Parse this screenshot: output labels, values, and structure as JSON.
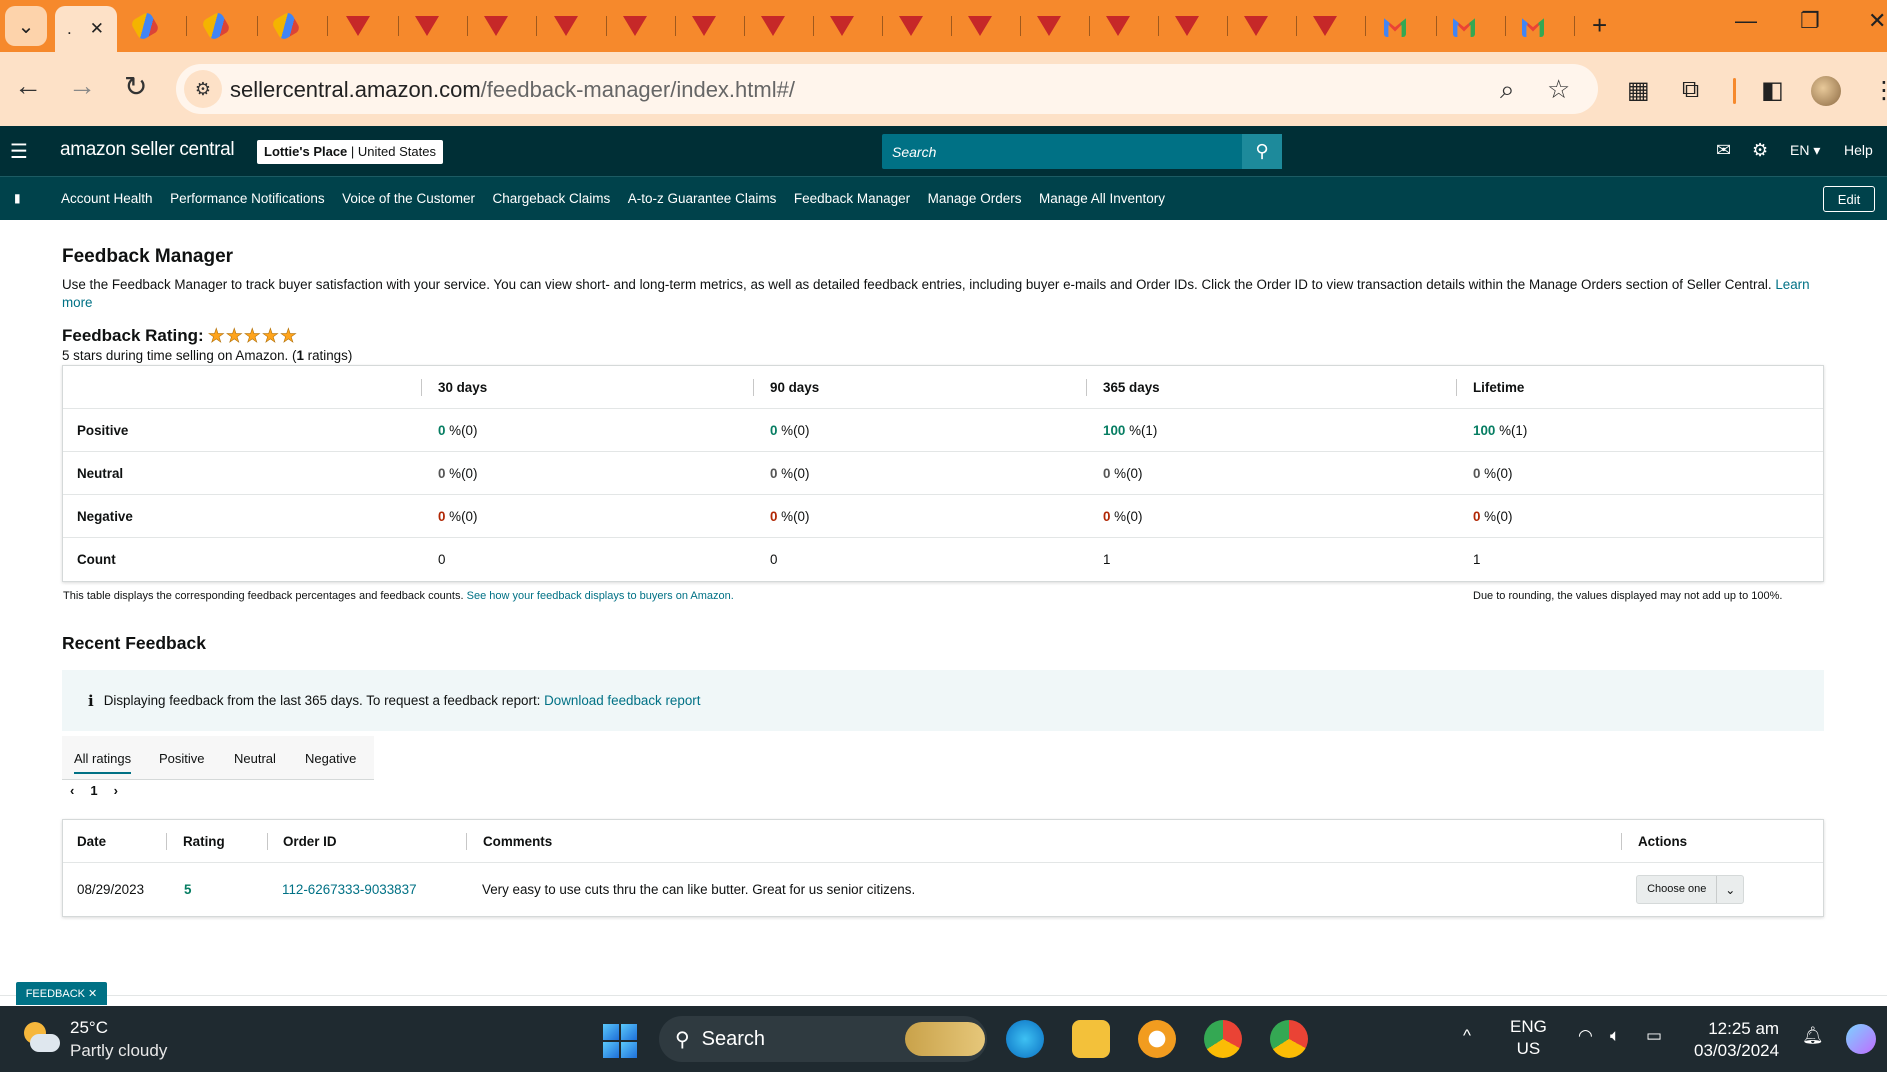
{
  "browser": {
    "tab_search_icon": "chevron-down-icon",
    "active_tab": {
      "label": ".",
      "close": "✕"
    },
    "new_tab": "+",
    "url_host": "sellercentral.amazon.com",
    "url_path": "/feedback-manager/index.html#/",
    "window_controls": [
      "—",
      "❐",
      "✕"
    ]
  },
  "header": {
    "logo_text": "amazon seller central",
    "store_name": "Lottie's Place",
    "store_region": "United States",
    "search_placeholder": "Search",
    "language": "EN ▾",
    "help": "Help"
  },
  "nav": {
    "items": [
      "Account Health",
      "Performance Notifications",
      "Voice of the Customer",
      "Chargeback Claims",
      "A-to-z Guarantee Claims",
      "Feedback Manager",
      "Manage Orders",
      "Manage All Inventory"
    ],
    "edit": "Edit"
  },
  "page": {
    "title": "Feedback Manager",
    "description": "Use the Feedback Manager to track buyer satisfaction with your service. You can view short- and long-term metrics, as well as detailed feedback entries, including buyer e-mails and Order IDs. Click the Order ID to view transaction details within the Manage Orders section of Seller Central.",
    "learn_more": "Learn more",
    "rating_label": "Feedback Rating:",
    "rating_stars": 5,
    "rating_sub_pre": "5 stars during time selling on Amazon. (",
    "rating_sub_count": "1",
    "rating_sub_post": " ratings)"
  },
  "ratings_table": {
    "columns": [
      "30 days",
      "90 days",
      "365 days",
      "Lifetime"
    ],
    "rows": [
      {
        "label": "Positive",
        "cells": [
          [
            "0",
            " %(0)"
          ],
          [
            "0",
            " %(0)"
          ],
          [
            "100",
            " %(1)"
          ],
          [
            "100",
            " %(1)"
          ]
        ]
      },
      {
        "label": "Neutral",
        "cells": [
          [
            "0",
            " %(0)"
          ],
          [
            "0",
            " %(0)"
          ],
          [
            "0",
            " %(0)"
          ],
          [
            "0",
            " %(0)"
          ]
        ]
      },
      {
        "label": "Negative",
        "cells": [
          [
            "0",
            " %(0)"
          ],
          [
            "0",
            " %(0)"
          ],
          [
            "0",
            " %(0)"
          ],
          [
            "0",
            " %(0)"
          ]
        ]
      },
      {
        "label": "Count",
        "cells": [
          [
            "0",
            ""
          ],
          [
            "0",
            ""
          ],
          [
            "1",
            ""
          ],
          [
            "1",
            ""
          ]
        ]
      }
    ],
    "note": "This table displays the corresponding feedback percentages and feedback counts.",
    "note_link": "See how your feedback displays to buyers on Amazon.",
    "rounding_note": "Due to rounding, the values displayed may not add up to 100%."
  },
  "recent": {
    "title": "Recent Feedback",
    "info_text": "Displaying feedback from the last 365 days. To request a feedback report:",
    "info_link": "Download feedback report",
    "tabs": [
      "All ratings",
      "Positive",
      "Neutral",
      "Negative"
    ],
    "page": "1",
    "columns": [
      "Date",
      "Rating",
      "Order ID",
      "Comments",
      "Actions"
    ],
    "rows": [
      {
        "date": "08/29/2023",
        "rating": "5",
        "order_id": "112-6267333-9033837",
        "comment": "Very easy to use cuts thru the can like butter. Great for us senior citizens.",
        "action": "Choose one"
      }
    ]
  },
  "feedback_tag": "FEEDBACK ✕",
  "taskbar": {
    "temp": "25°C",
    "weather": "Partly cloudy",
    "search": "Search",
    "lang1": "ENG",
    "lang2": "US",
    "time": "12:25 am",
    "date": "03/03/2024"
  }
}
